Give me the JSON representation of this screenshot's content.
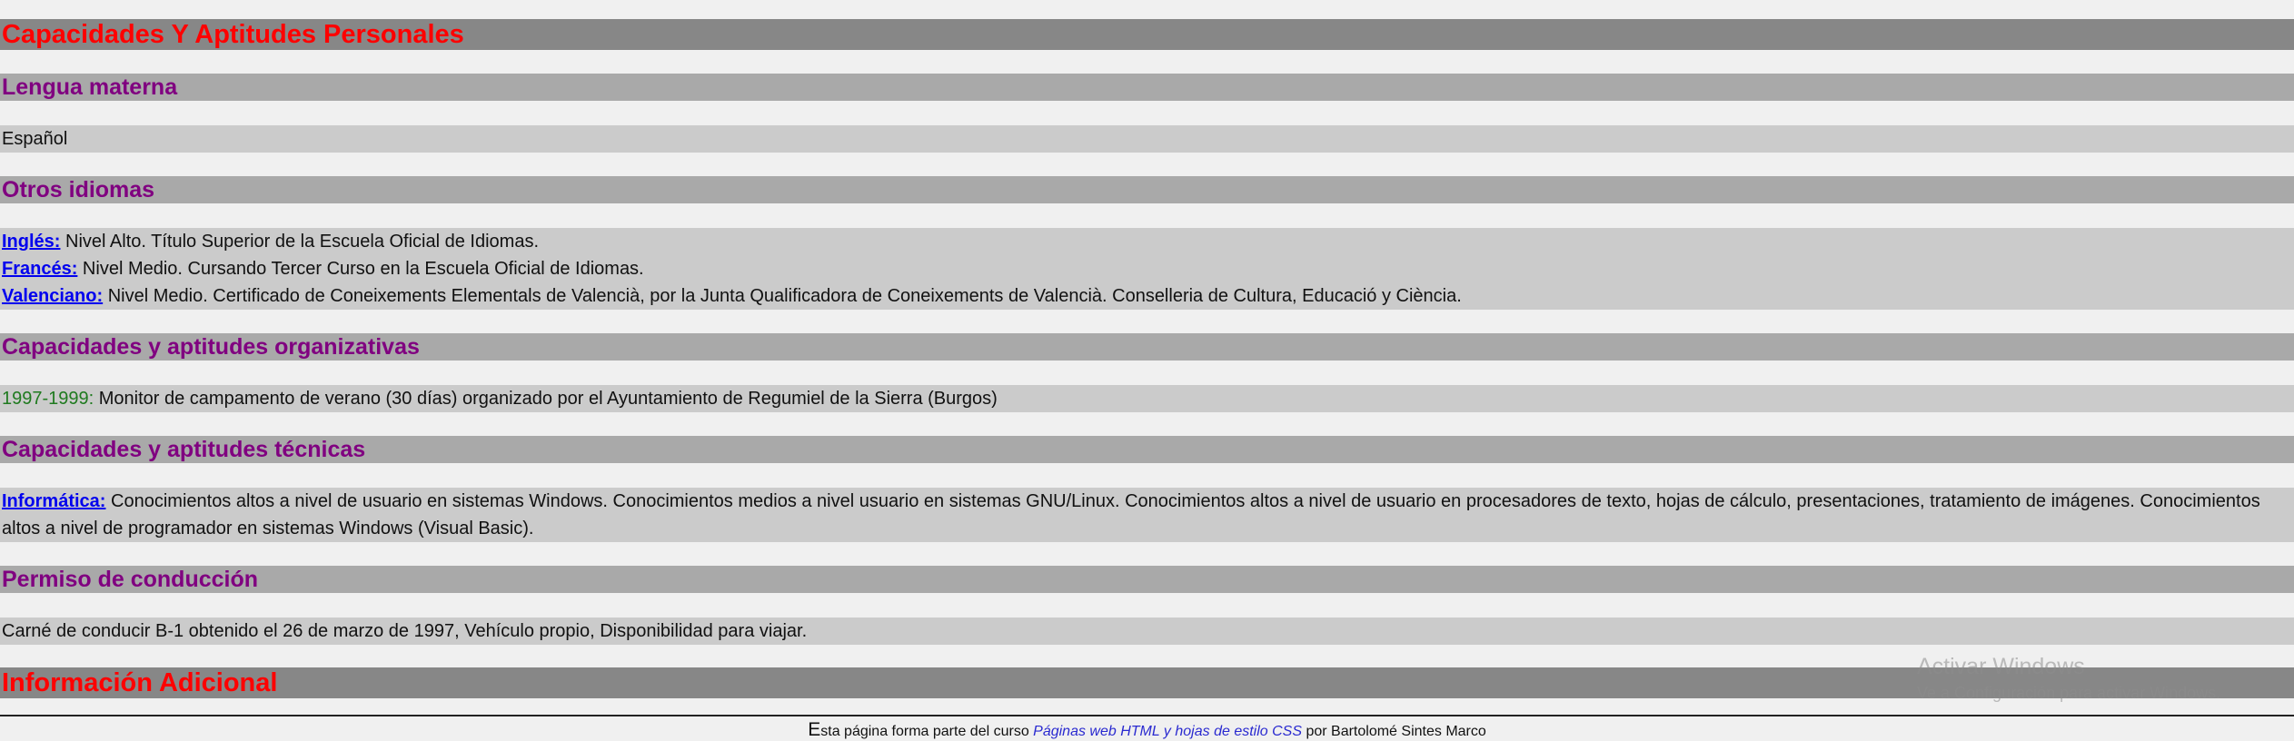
{
  "headings": {
    "capacidades": "Capacidades Y Aptitudes Personales",
    "informacion": "Información Adicional"
  },
  "sections": {
    "lengua": {
      "title": "Lengua materna",
      "text": "Español"
    },
    "idiomas": {
      "title": "Otros idiomas",
      "items": [
        {
          "label": "Inglés:",
          "text": " Nivel Alto. Título Superior de la Escuela Oficial de Idiomas."
        },
        {
          "label": "Francés:",
          "text": " Nivel Medio. Cursando Tercer Curso en la Escuela Oficial de Idiomas."
        },
        {
          "label": "Valenciano:",
          "text": " Nivel Medio. Certificado de Coneixements Elementals de Valencià, por la Junta Qualificadora de Coneixements de Valencià. Conselleria de Cultura, Educació y Ciència."
        }
      ]
    },
    "organizativas": {
      "title": "Capacidades y aptitudes organizativas",
      "year": "1997-1999:",
      "text": " Monitor de campamento de verano (30 días) organizado por el Ayuntamiento de Regumiel de la Sierra (Burgos)"
    },
    "tecnicas": {
      "title": "Capacidades y aptitudes técnicas",
      "label": "Informática:",
      "text": " Conocimientos altos a nivel de usuario en sistemas Windows. Conocimientos medios a nivel usuario en sistemas GNU/Linux. Conocimientos altos a nivel de usuario en procesadores de texto, hojas de cálculo, presentaciones, tratamiento de imágenes. Conocimientos altos a nivel de programador en sistemas Windows (Visual Basic)."
    },
    "conduccion": {
      "title": "Permiso de conducción",
      "text": "Carné de conducir B-1 obtenido el 26 de marzo de 1997, Vehículo propio, Disponibilidad para viajar."
    }
  },
  "footer": {
    "initial": "E",
    "prefix": "sta página forma parte del curso ",
    "link": "Páginas web HTML y hojas de estilo CSS",
    "suffix": " por Bartolomé Sintes Marco"
  },
  "watermark": {
    "title": "Activar Windows",
    "subtitle": "Ve a Configuración para activar Windows."
  }
}
